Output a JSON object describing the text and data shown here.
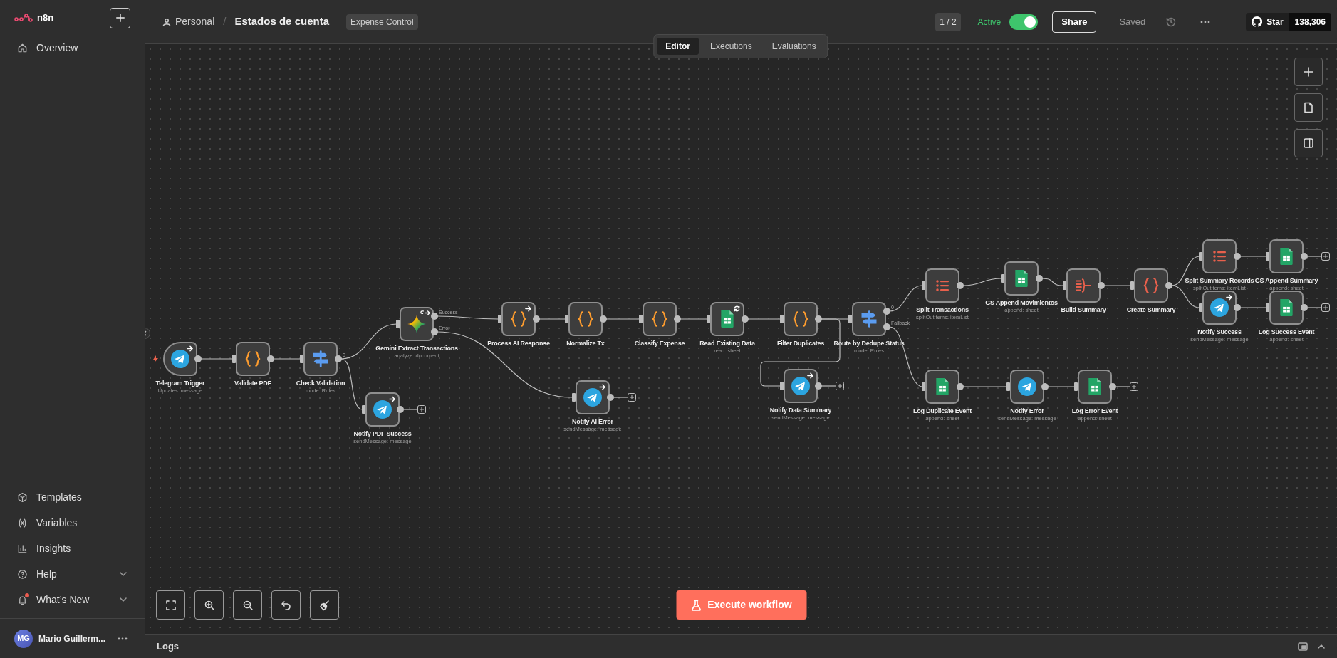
{
  "sidebar": {
    "logo": "n8n",
    "nav": [
      {
        "label": "Overview"
      }
    ],
    "bottom_nav": [
      {
        "label": "Templates"
      },
      {
        "label": "Variables"
      },
      {
        "label": "Insights"
      },
      {
        "label": "Help",
        "expandable": true
      },
      {
        "label": "What’s New",
        "expandable": true,
        "unread": true
      }
    ],
    "user": {
      "initials": "MG",
      "name": "Mario Guillerm..."
    }
  },
  "header": {
    "project": "Personal",
    "separator": "/",
    "workflow": "Estados de cuenta",
    "tag": "Expense Control",
    "version": "1 / 2",
    "active": {
      "label": "Active",
      "on": true
    },
    "share": "Share",
    "save_status": "Saved",
    "github": {
      "label": "Star",
      "count": "138,306"
    }
  },
  "tabs": [
    {
      "label": "Editor",
      "selected": true
    },
    {
      "label": "Executions",
      "selected": false
    },
    {
      "label": "Evaluations",
      "selected": false
    }
  ],
  "nodes": [
    {
      "title": "Telegram Trigger",
      "subtitle": "Updates: message",
      "kind": "trigger",
      "arrow_badge": true
    },
    {
      "title": "Validate PDF",
      "kind": "code"
    },
    {
      "title": "Check Validation",
      "subtitle": "mode: Rules",
      "kind": "switch",
      "outputs": [
        "0"
      ]
    },
    {
      "title": "Gemini Extract Transactions",
      "subtitle": "analyze: document",
      "kind": "gemini",
      "loop_badge": true,
      "outputs": [
        "Success",
        "Error"
      ]
    },
    {
      "title": "Notify PDF Success",
      "subtitle": "sendMessage: message",
      "kind": "telegram",
      "arrow_badge": true,
      "open_end": true
    },
    {
      "title": "Process AI Response",
      "kind": "code",
      "arrow_badge": true
    },
    {
      "title": "Normalize Tx",
      "kind": "code"
    },
    {
      "title": "Notify AI Error",
      "subtitle": "sendMessage: message",
      "kind": "telegram",
      "arrow_badge": true,
      "open_end": true
    },
    {
      "title": "Classify Expense",
      "kind": "code"
    },
    {
      "title": "Read Existing Data",
      "subtitle": "read: sheet",
      "kind": "sheets",
      "refresh_badge": true
    },
    {
      "title": "Filter Duplicates",
      "kind": "code"
    },
    {
      "title": "Route by Dedupe Status",
      "subtitle": "mode: Rules",
      "kind": "switch",
      "outputs": [
        "0",
        "Fallback"
      ]
    },
    {
      "title": "Notify Data Summary",
      "subtitle": "sendMessage: message",
      "kind": "telegram",
      "arrow_badge": true,
      "open_end": true
    },
    {
      "title": "Split Transactions",
      "subtitle": "splitOutItems: itemList",
      "kind": "split"
    },
    {
      "title": "GS Append Movimientos",
      "subtitle": "append: sheet",
      "kind": "sheets"
    },
    {
      "title": "Build Summary",
      "kind": "aggregate"
    },
    {
      "title": "Create Summary",
      "kind": "set"
    },
    {
      "title": "Split Summary Records",
      "subtitle": "splitOutItems: itemList",
      "kind": "split"
    },
    {
      "title": "GS Append Summary",
      "subtitle": "append: sheet",
      "kind": "sheets",
      "open_end": true
    },
    {
      "title": "Notify Success",
      "subtitle": "sendMessage: message",
      "kind": "telegram",
      "arrow_badge": true
    },
    {
      "title": "Log Success Event",
      "subtitle": "append: sheet",
      "kind": "sheets",
      "open_end": true
    },
    {
      "title": "Log Duplicate Event",
      "subtitle": "append: sheet",
      "kind": "sheets"
    },
    {
      "title": "Notify Error",
      "subtitle": "sendMessage: message",
      "kind": "telegram"
    },
    {
      "title": "Log Error Event",
      "subtitle": "append: sheet",
      "kind": "sheets",
      "open_end": true
    }
  ],
  "execute_button": "Execute workflow",
  "logs": {
    "title": "Logs"
  }
}
